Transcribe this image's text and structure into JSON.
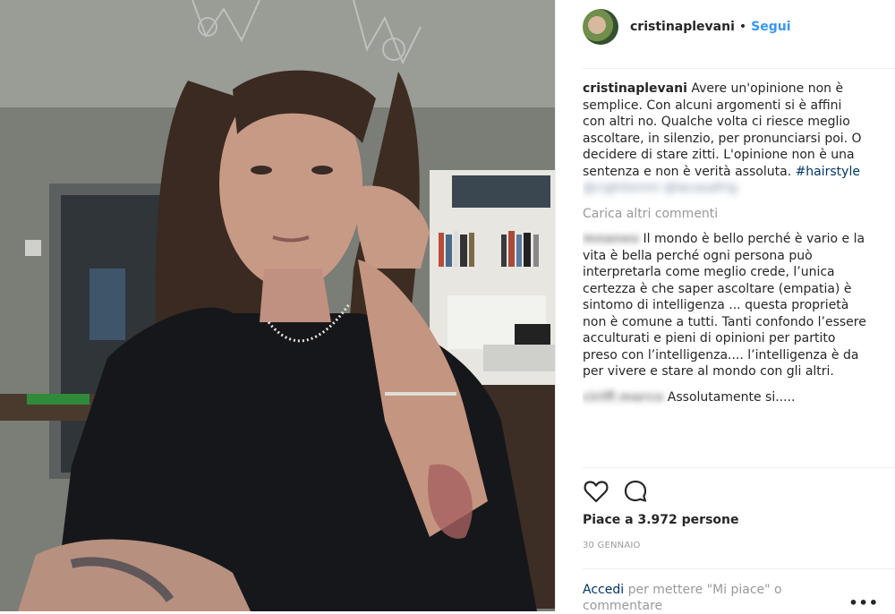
{
  "post": {
    "username": "cristinaplevani",
    "dot": "•",
    "follow_label": "Segui",
    "caption": {
      "user": "cristinaplevani",
      "text": "Avere un'opinione non è semplice. Con alcuni argomenti si è affini con altri no. Qualche volta ci riesce meglio ascoltare, in silenzio, per pronunciarsi poi. O decidere di stare zitti. L'opinione non è una sentenza e non è verità assoluta.",
      "hashtag": "#hairstyle",
      "blurred_tags": "@cighilonmi @lacasafrig"
    },
    "load_more_label": "Carica altri commenti",
    "comments": [
      {
        "user": "mnaneo",
        "text": "Il mondo è bello perché è vario e la vita è bella perché ogni persona può interpretarla come meglio crede, l’unica certezza è che saper ascoltare (empatia) è sintomo di intelligenza ... questa proprietà non è comune a tutti. Tanti confondo l’essere acculturati e pieni di opinioni per partito preso con l’intelligenza.... l’intelligenza è da per vivere e stare al mondo con gli altri."
      },
      {
        "user": "ciriff.marco",
        "text": "Assolutamente si....."
      }
    ],
    "likes_label": "Piace a 3.972 persone",
    "date_label": "30 gennaio",
    "login": {
      "link_label": "Accedi",
      "rest": "per mettere \"Mi piace\" o commentare"
    },
    "more_label": "•••",
    "icons": [
      "heart-icon",
      "comment-icon"
    ]
  }
}
